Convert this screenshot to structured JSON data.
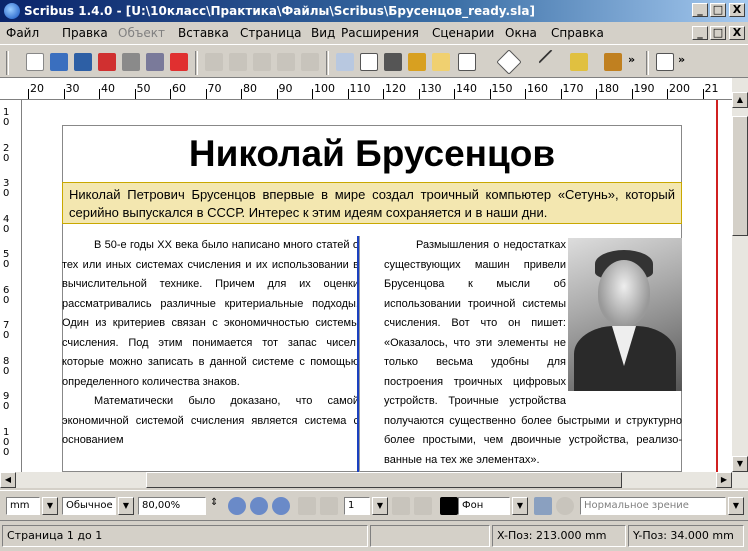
{
  "window": {
    "title": "Scribus 1.4.0 - [U:\\10класс\\Практика\\Файлы\\Scribus\\Брусенцов_ready.sla]",
    "min": "_",
    "max": "□",
    "close": "X"
  },
  "menu": {
    "items": [
      "Файл",
      "Правка",
      "Объект",
      "Вставка",
      "Страница",
      "Вид",
      "Расширения",
      "Сценарии",
      "Окна",
      "Справка"
    ]
  },
  "ruler": {
    "h_ticks": [
      "20",
      "30",
      "40",
      "50",
      "60",
      "70",
      "80",
      "90",
      "100",
      "110",
      "120",
      "130",
      "140",
      "150",
      "160",
      "170",
      "180",
      "190",
      "200",
      "21"
    ],
    "v_ticks": [
      "10",
      "20",
      "30",
      "40",
      "50",
      "60",
      "70",
      "80",
      "90",
      "100"
    ]
  },
  "document": {
    "heading": "Николай Брусенцов",
    "lead": "Николай Петрович Брусенцов впервые в мире создал троичный компьютер «Сетунь», который серийно выпускался в СССР. Интерес к этим идеям сохраняется и в наши дни.",
    "col1_p1": "В 50-е годы XX века было написано много статей о тех или иных системах счисления и их использовании в вычислительной технике. Причем для их оценки рассматривались различные критериальные подходы. Один из критериев связан с экономичностью системы счисления. Под этим понимается тот запас чисел, которые можно записать в данной системе с помощью определенного количества знаков.",
    "col1_p2": "Математически было доказано, что самой экономичной системой счисления является система с основанием",
    "col2_text": "Размышления о недостатках существующих машин привели Брусенцова к мысли об использовании троичной системы счисления. Вот что он пишет: «Оказалось, что эти элементы не только весьма удобны для построения троичных цифровых устройств. Троичные устройства получаются существенно более быстрыми и структурно более простыми, чем двоичные устройства, реализо-ванные на тех же элементах»."
  },
  "bottombar": {
    "unit": "mm",
    "mode": "Обычное",
    "zoom": "80,00%",
    "page": "1",
    "layer": "Фон",
    "view": "Нормальное зрение"
  },
  "status": {
    "page": "Страница 1 до 1",
    "xpos": "X-Поз:  213.000  mm",
    "ypos": "Y-Поз:  34.000  mm"
  }
}
